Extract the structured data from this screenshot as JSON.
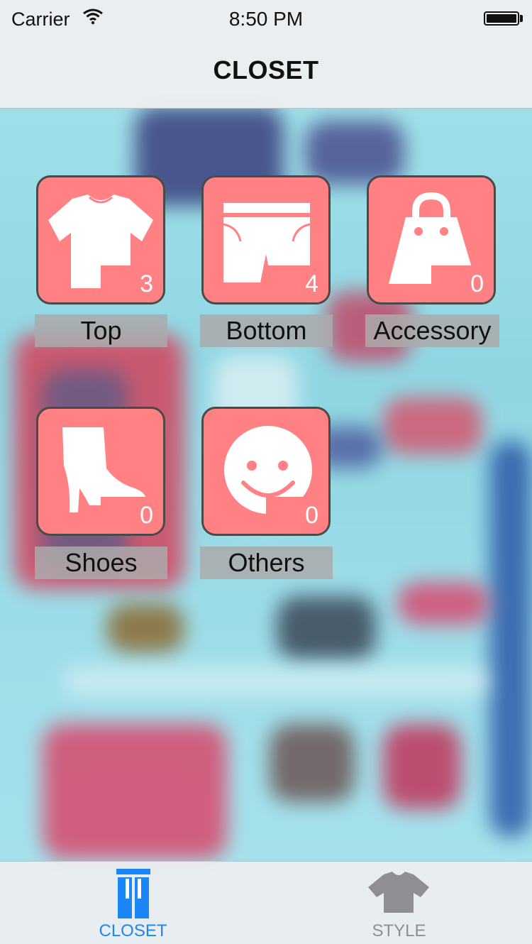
{
  "status_bar": {
    "carrier": "Carrier",
    "time": "8:50 PM"
  },
  "nav": {
    "title": "CLOSET"
  },
  "categories": [
    {
      "label": "Top",
      "count": "3",
      "icon": "tshirt-icon"
    },
    {
      "label": "Bottom",
      "count": "4",
      "icon": "shorts-icon"
    },
    {
      "label": "Accessory",
      "count": "0",
      "icon": "bag-icon"
    },
    {
      "label": "Shoes",
      "count": "0",
      "icon": "boot-icon"
    },
    {
      "label": "Others",
      "count": "0",
      "icon": "smiley-icon"
    }
  ],
  "tab_bar": {
    "tabs": [
      {
        "label": "CLOSET",
        "icon": "closet-icon",
        "selected": true
      },
      {
        "label": "STYLE",
        "icon": "shirt-icon",
        "selected": false
      }
    ]
  },
  "colors": {
    "tile": "#ff8183",
    "tab_active": "#1a86f7",
    "tab_inactive": "#8e8e93"
  }
}
